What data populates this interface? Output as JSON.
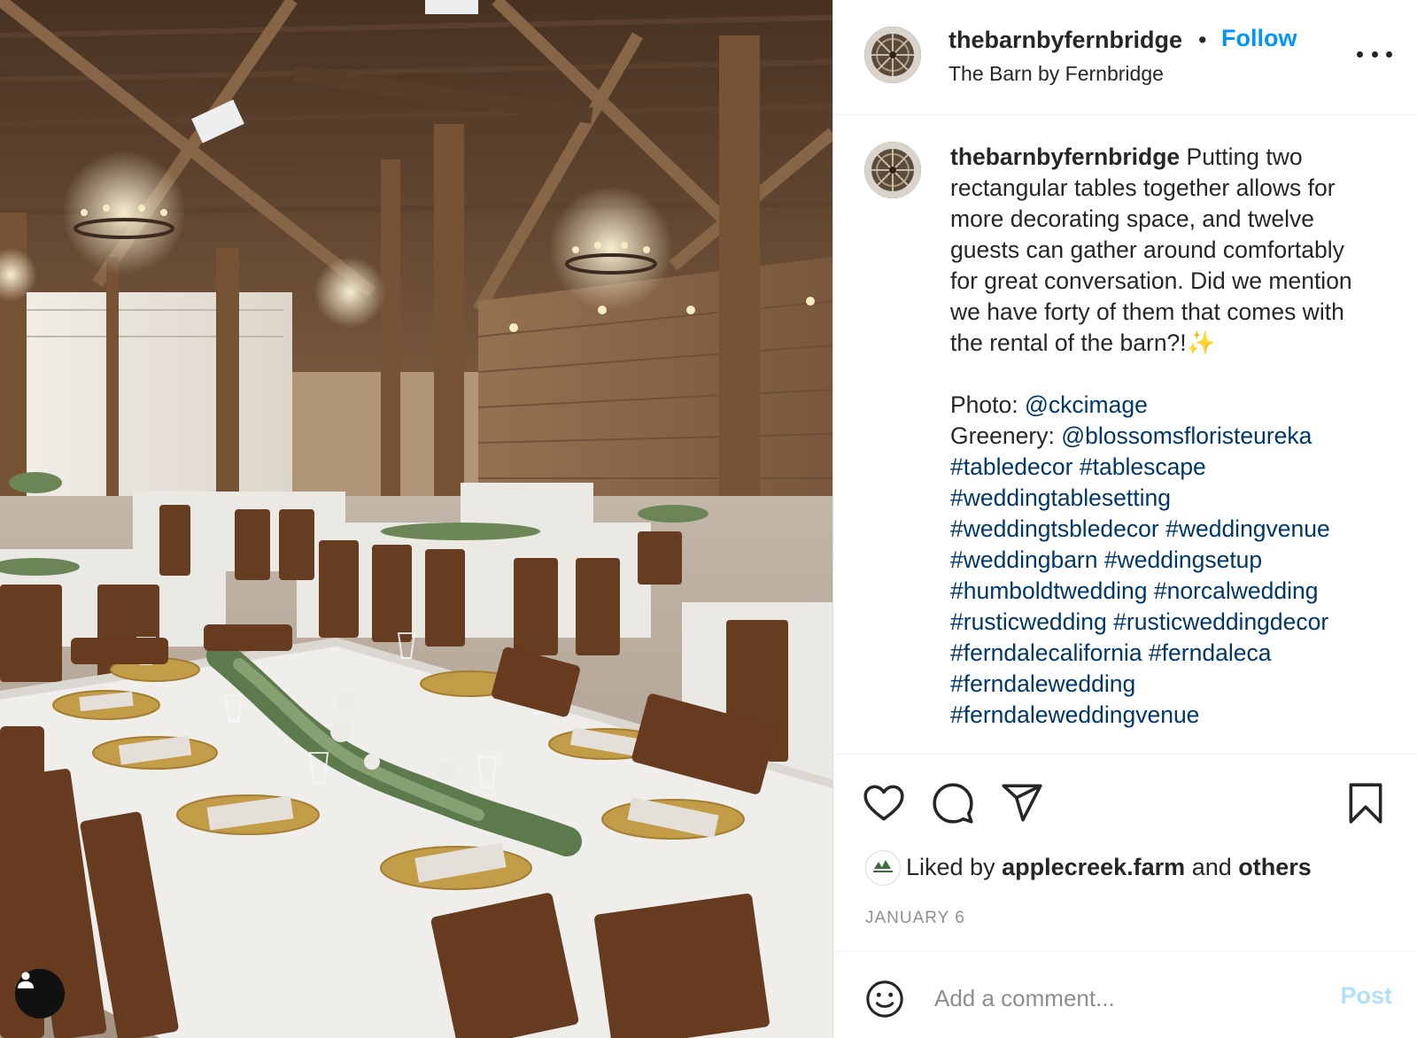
{
  "account": {
    "username": "thebarnbyfernbridge",
    "location": "The Barn by Fernbridge",
    "follow_label": "Follow",
    "separator": "•"
  },
  "caption": {
    "username": "thebarnbyfernbridge",
    "lines": [
      "Putting two",
      "rectangular tables together allows for",
      "more decorating space, and twelve",
      "guests can gather around comfortably",
      "for great conversation. Did we mention",
      "we have forty of them that comes with",
      "the rental of the barn?!"
    ],
    "sparkle": "✨",
    "photo_label": "Photo: ",
    "photo_credit": "@ckcimage",
    "greenery_label": "Greenery: ",
    "greenery_credit": "@blossomsfloristeureka",
    "hashtag_lines": [
      [
        "#tabledecor",
        "#tablescape"
      ],
      [
        "#weddingtablesetting"
      ],
      [
        "#weddingtsbledecor",
        "#weddingvenue"
      ],
      [
        "#weddingbarn",
        "#weddingsetup"
      ],
      [
        "#humboldtwedding",
        "#norcalwedding"
      ],
      [
        "#rusticwedding",
        "#rusticweddingdecor"
      ],
      [
        "#ferndalecalifornia",
        "#ferndaleca"
      ],
      [
        "#ferndalewedding"
      ],
      [
        "#ferndaleweddingvenue"
      ]
    ]
  },
  "likes": {
    "prefix": "Liked by ",
    "liker": "applecreek.farm",
    "middle": " and ",
    "others": "others"
  },
  "date": "JANUARY 6",
  "comment": {
    "placeholder": "Add a comment...",
    "post_label": "Post"
  },
  "icons": {
    "like": "heart-icon",
    "comment": "comment-bubble-icon",
    "share": "paper-plane-icon",
    "save": "bookmark-icon",
    "more": "more-options-icon",
    "emoji": "smiley-icon",
    "tags": "user-tag-icon"
  },
  "colors": {
    "link": "#00376b",
    "follow": "#0095f6",
    "post_disabled": "#b2dffc",
    "muted": "#8e8e8e"
  }
}
